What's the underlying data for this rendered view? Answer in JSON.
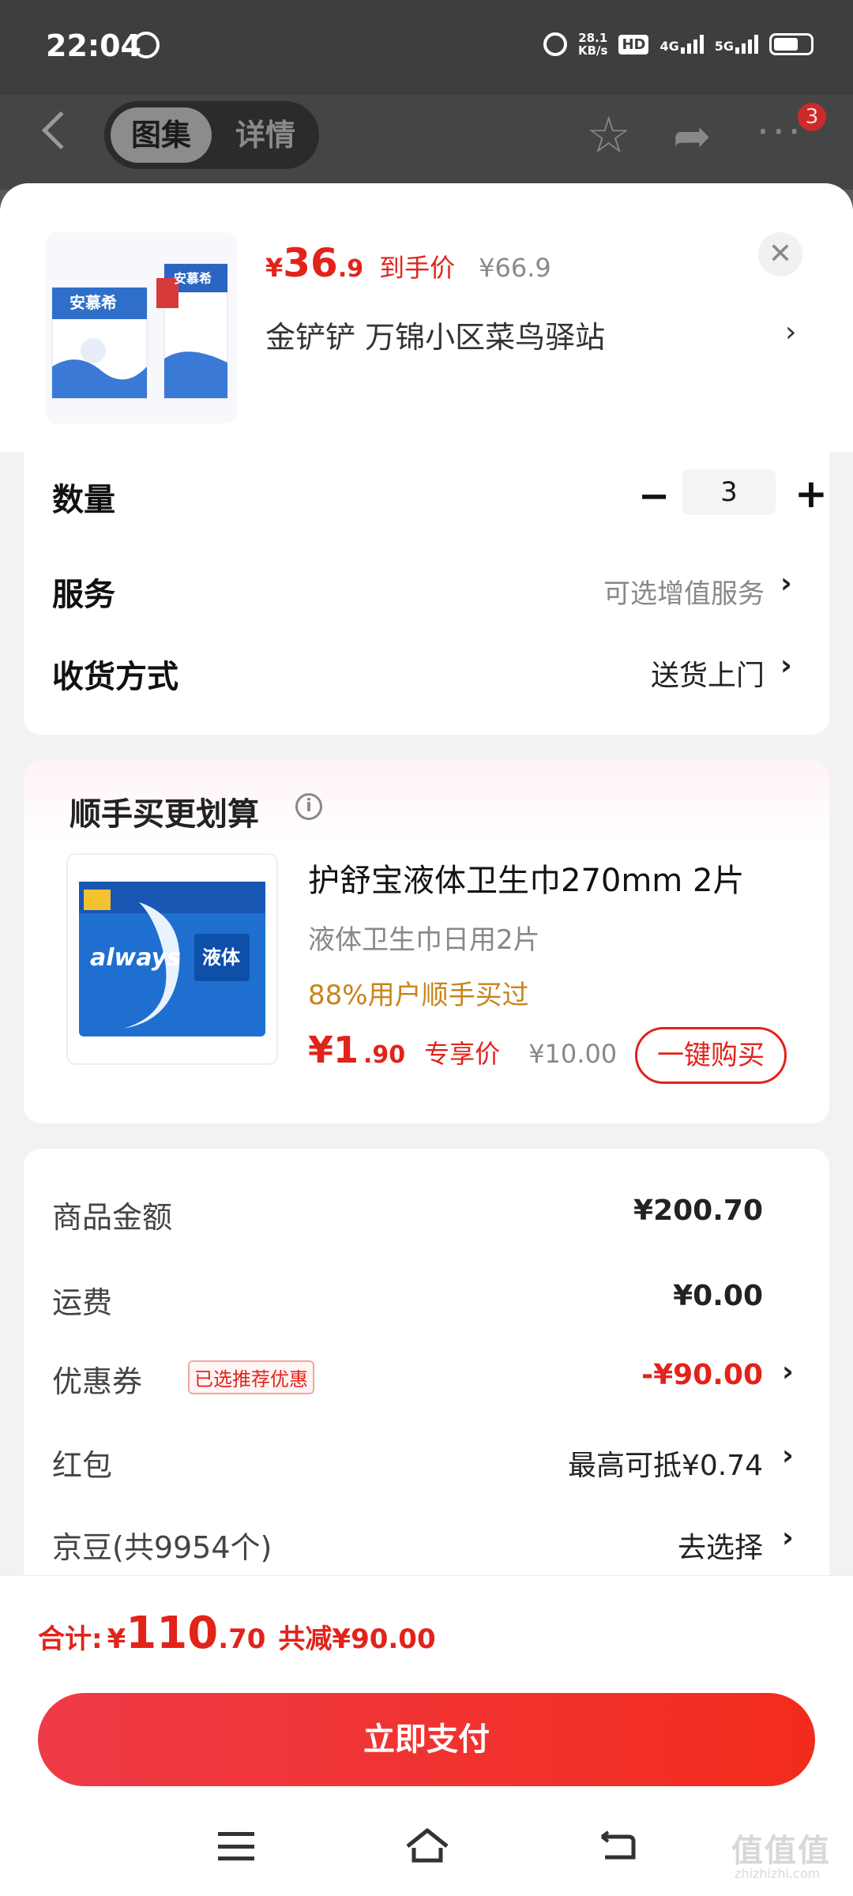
{
  "status": {
    "time": "22:04",
    "speed_top": "28.1",
    "speed_unit": "KB/s",
    "hd": "HD",
    "net1": "4G",
    "net2": "5G"
  },
  "topnav": {
    "tab_gallery": "图集",
    "tab_details": "详情",
    "badge_count": "3"
  },
  "product": {
    "yen": "¥",
    "price_int": "36",
    "price_dec": ".9",
    "price_tag": "到手价",
    "orig_price": "¥66.9",
    "station": "金铲铲  万锦小区菜鸟驿站",
    "thumb_brand": "安慕希"
  },
  "options": {
    "quantity_label": "数量",
    "quantity_value": "3",
    "service_label": "服务",
    "service_value": "可选增值服务",
    "delivery_label": "收货方式",
    "delivery_value": "送货上门"
  },
  "bundle": {
    "title": "顺手买更划算",
    "name": "护舒宝液体卫生巾270mm 2片",
    "sub": "液体卫生巾日用2片",
    "pct": "88%用户顺手买过",
    "price_int": "¥1",
    "price_dec": ".90",
    "price_tag": "专享价",
    "orig_price": "¥10.00",
    "buy_label": "一键购买",
    "img_brand": "always",
    "img_text": "液体"
  },
  "summary": {
    "goods_label": "商品金额",
    "goods_value": "¥200.70",
    "shipping_label": "运费",
    "shipping_value": "¥0.00",
    "coupon_label": "优惠券",
    "coupon_tag": "已选推荐优惠",
    "coupon_value": "-¥90.00",
    "redpacket_label": "红包",
    "redpacket_value": "最高可抵¥0.74",
    "beans_label": "京豆(共9954个)",
    "beans_value": "去选择"
  },
  "footer": {
    "total_label": "合计:",
    "total_yen": "¥",
    "total_int": "110",
    "total_dec": ".70",
    "total_off": "共减¥90.00",
    "pay_label": "立即支付"
  },
  "watermark": {
    "main": "值值值",
    "sub": "zhizhizhi.com"
  },
  "colors": {
    "accent": "#e2231a",
    "orange": "#c8841b"
  }
}
